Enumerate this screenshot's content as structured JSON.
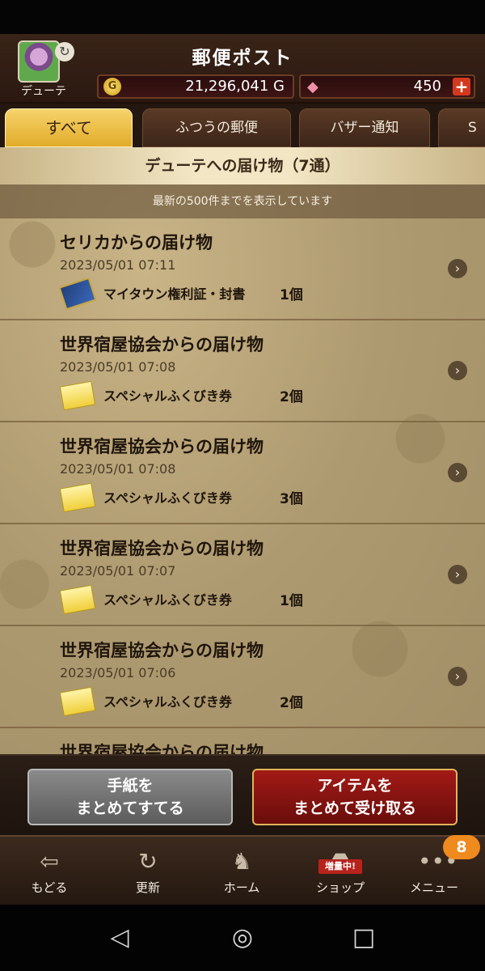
{
  "header": {
    "title": "郵便ポスト",
    "player_name": "デューテ",
    "gold_icon": "G",
    "gold": "21,296,041 G",
    "gems": "450",
    "gem_add_label": "+"
  },
  "tabs": [
    {
      "label": "すべて",
      "active": true
    },
    {
      "label": "ふつうの郵便",
      "active": false
    },
    {
      "label": "バザー通知",
      "active": false
    },
    {
      "label": "S",
      "active": false
    }
  ],
  "inbox": {
    "heading": "デューテへの届け物（7通）",
    "notice": "最新の500件までを表示しています"
  },
  "mails": [
    {
      "title": "セリカからの届け物",
      "date": "2023/05/01 07:11",
      "item": "マイタウン権利証・封書",
      "qty": "1個",
      "icon": "scroll"
    },
    {
      "title": "世界宿屋協会からの届け物",
      "date": "2023/05/01 07:08",
      "item": "スペシャルふくびき券",
      "qty": "2個",
      "icon": "ticket"
    },
    {
      "title": "世界宿屋協会からの届け物",
      "date": "2023/05/01 07:08",
      "item": "スペシャルふくびき券",
      "qty": "3個",
      "icon": "ticket"
    },
    {
      "title": "世界宿屋協会からの届け物",
      "date": "2023/05/01 07:07",
      "item": "スペシャルふくびき券",
      "qty": "1個",
      "icon": "ticket"
    },
    {
      "title": "世界宿屋協会からの届け物",
      "date": "2023/05/01 07:06",
      "item": "スペシャルふくびき券",
      "qty": "2個",
      "icon": "ticket"
    },
    {
      "title": "世界宿屋協会からの届け物",
      "date": "",
      "item": "",
      "qty": "",
      "icon": "ticket"
    }
  ],
  "actions": {
    "discard_line1": "手紙を",
    "discard_line2": "まとめてすてる",
    "receive_line1": "アイテムを",
    "receive_line2": "まとめて受け取る"
  },
  "nav": {
    "back": "もどる",
    "refresh": "更新",
    "home": "ホーム",
    "shop": "ショップ",
    "shop_tag": "増量中!",
    "menu": "メニュー",
    "menu_badge": "8"
  },
  "colors": {
    "accent_tab": "#e1ac2a",
    "receive_button": "#a21a16",
    "discard_button": "#8a8a8a",
    "badge": "#ef8a1e"
  }
}
